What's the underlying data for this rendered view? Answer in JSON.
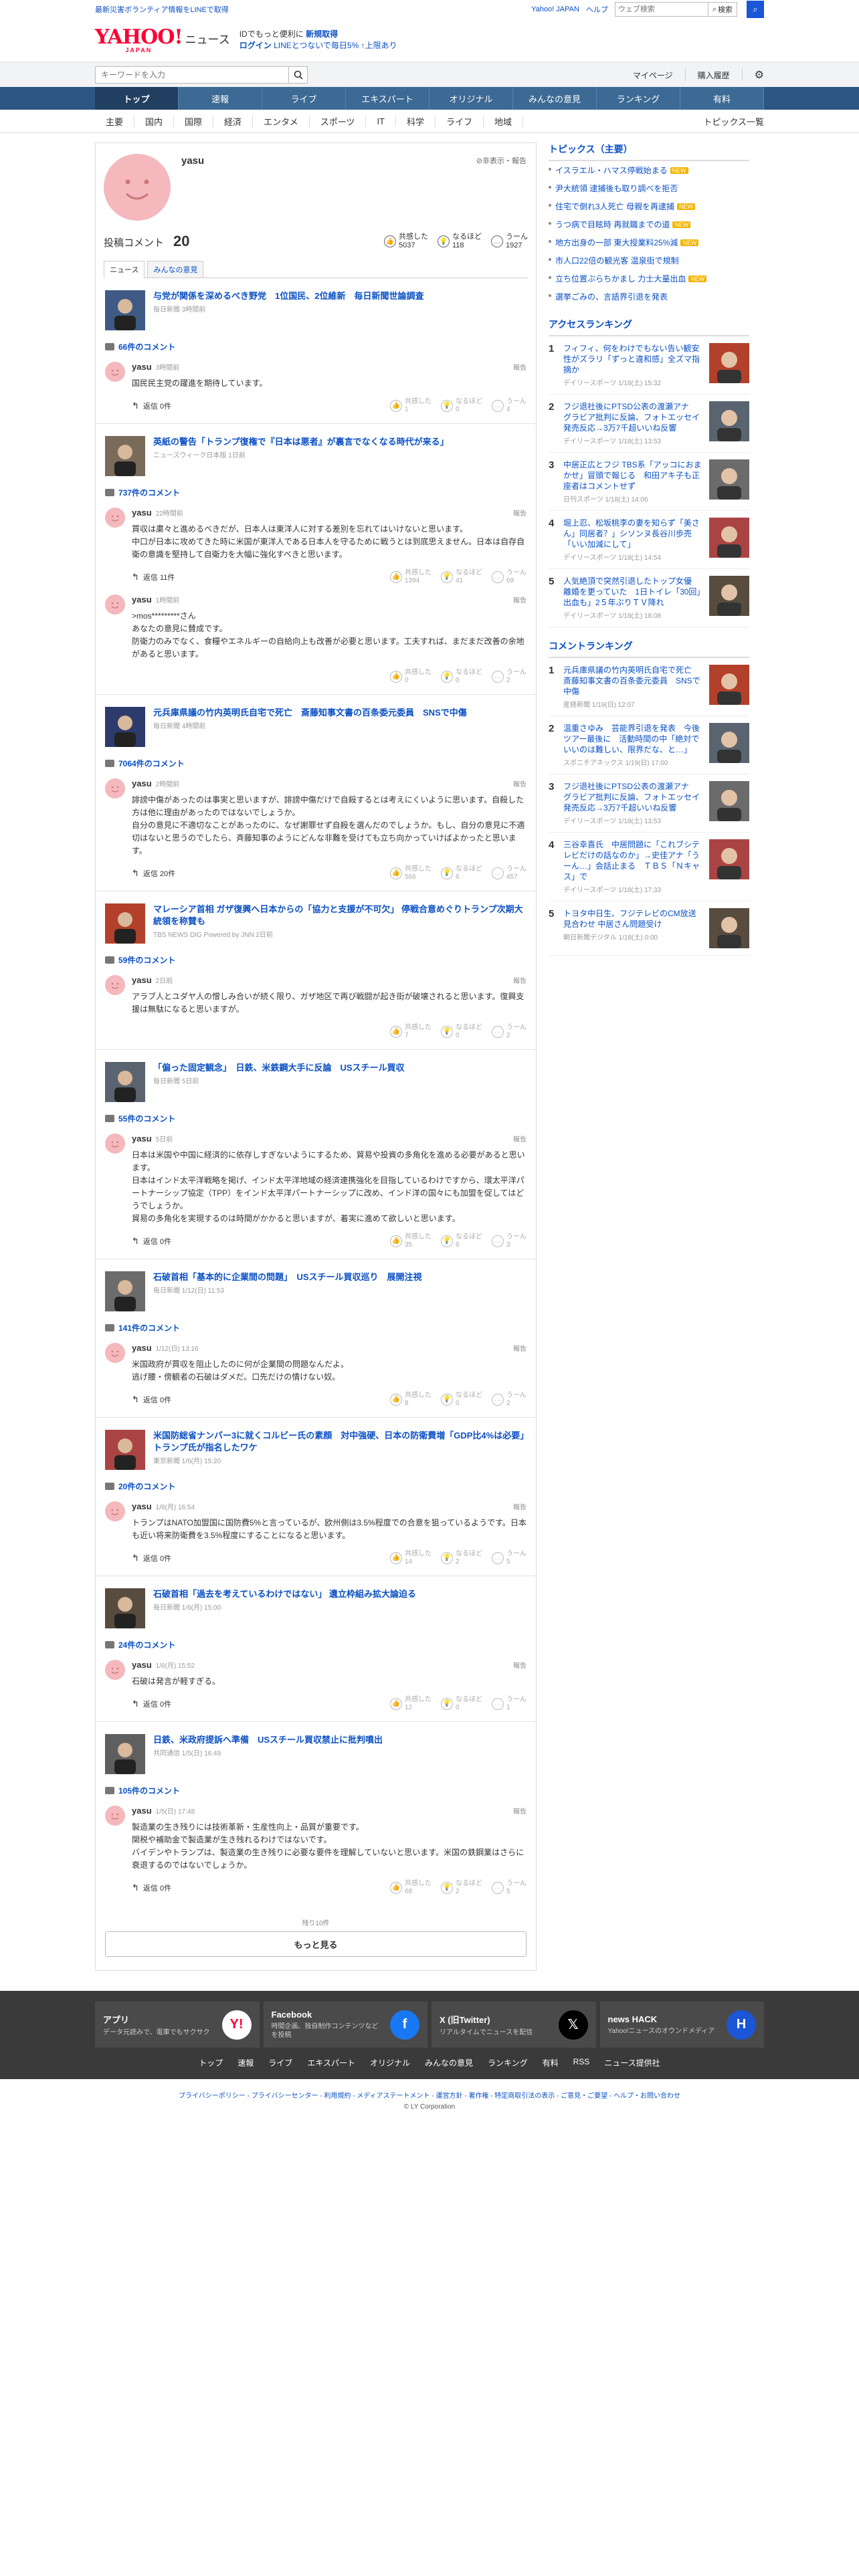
{
  "topstrip": {
    "disaster_link": "最新災害ボランティア情報をLINEで取得",
    "links": [
      "Yahoo! JAPAN",
      "ヘルプ"
    ],
    "search_placeholder": "ウェブ検索",
    "search_button": "検索"
  },
  "logo": {
    "yahoo": "YAHOO!",
    "japan": "JAPAN",
    "news": "ニュース"
  },
  "promo": {
    "line1_prefix": "IDでもっと便利に",
    "line1_link": "新規取得",
    "line2_link": "ログイン",
    "line2_text": "LINEとつないで毎日5% ↑上限あり"
  },
  "searchrow": {
    "placeholder": "キーワードを入力",
    "mypage": "マイページ",
    "history": "購入履歴"
  },
  "mainnav": [
    "トップ",
    "速報",
    "ライブ",
    "エキスパート",
    "オリジナル",
    "みんなの意見",
    "ランキング",
    "有料"
  ],
  "subnav": [
    "主要",
    "国内",
    "国際",
    "経済",
    "エンタメ",
    "スポーツ",
    "IT",
    "科学",
    "ライフ",
    "地域"
  ],
  "subnav_right": "トピックス一覧",
  "profile": {
    "name": "yasu",
    "private_note": "非表示・報告",
    "count_label": "投稿コメント",
    "count": "20",
    "reactions": [
      {
        "label": "共感した",
        "value": "5037",
        "icon": "thumb-icon"
      },
      {
        "label": "なるほど",
        "value": "118",
        "icon": "bulb-icon"
      },
      {
        "label": "うーん",
        "value": "1927",
        "icon": "hmm-icon"
      }
    ],
    "tabs": [
      "ニュース",
      "みんなの意見"
    ]
  },
  "articles": [
    {
      "title": "与党が関係を深めるべき野党　1位国民、2位維新　毎日新聞世論調査",
      "source": "毎日新聞 3時間前",
      "comment_count": "66件のコメント",
      "comments": [
        {
          "user": "yasu",
          "time": "3時間前",
          "text": "国民民主党の躍進を期待しています。",
          "reply": "返信 0件",
          "votes": [
            "共感した\n1",
            "なるほど\n0",
            "うーん\n4"
          ]
        }
      ]
    },
    {
      "title": "英紙の警告「トランプ復権で『日本は悪者』が裏言でなくなる時代が来る」",
      "source": "ニューズウィーク日本版 1日前",
      "comment_count": "737件のコメント",
      "comments": [
        {
          "user": "yasu",
          "time": "22時間前",
          "text": "買収は粛々と進めるべきだが、日本人は東洋人に対する差別を忘れてはいけないと思います。\n中口が日本に攻めてきた時に米国が東洋人である日本人を守るために戦うとは到底思えません。日本は自存自衛の意識を堅持して自衛力を大幅に強化すべきと思います。",
          "reply": "返信 11件",
          "votes": [
            "共感した\n1394",
            "なるほど\n41",
            "うーん\n69"
          ]
        },
        {
          "user": "yasu",
          "time": "1時間前",
          "text": ">mos*********さん\nあなたの意見に賛成です。\n防衛力のみでなく、食糧やエネルギーの自給向上も改善が必要と思います。工夫すれば、まだまだ改善の余地があると思います。",
          "reply": "",
          "votes": [
            "共感した\n0",
            "なるほど\n0",
            "うーん\n2"
          ]
        }
      ]
    },
    {
      "title": "元兵庫県議の竹内英明氏自宅で死亡　斎藤知事文書の百条委元委員　SNSで中傷",
      "source": "毎日新聞 4時間前",
      "comment_count": "7064件のコメント",
      "comments": [
        {
          "user": "yasu",
          "time": "2時間前",
          "text": "誹謗中傷があったのは事実と思いますが、誹謗中傷だけで自殺するとは考えにくいように思います。自殺した方は他に理由があったのではないでしょうか。\n自分の意見に不適切なことがあったのに、なぜ謝罪せず自殺を選んだのでしょうか。もし、自分の意見に不適切はないと思うのでしたら、斉藤知事のようにどんな非難を受けても立ち向かっていけばよかったと思います。",
          "reply": "返信 20件",
          "votes": [
            "共感した\n566",
            "なるほど\n6",
            "うーん\n457"
          ]
        }
      ]
    },
    {
      "title": "マレーシア首相 ガザ復興へ日本からの「協力と支援が不可欠」 停戦合意めぐりトランプ次期大統領を称賛も",
      "source": "TBS NEWS DIG Powered by JNN 2日前",
      "comment_count": "59件のコメント",
      "comments": [
        {
          "user": "yasu",
          "time": "2日前",
          "text": "アラブ人とユダヤ人の憎しみ合いが続く限り、ガザ地区で再び戦闘が起き街が破壊されると思います。復興支援は無駄になると思いますが。",
          "reply": "",
          "votes": [
            "共感した\n7",
            "なるほど\n0",
            "うーん\n2"
          ]
        }
      ]
    },
    {
      "title": "「偏った固定観念」　日鉄、米鉄鋼大手に反論　USスチール買収",
      "source": "毎日新聞 5日前",
      "comment_count": "55件のコメント",
      "comments": [
        {
          "user": "yasu",
          "time": "5日前",
          "text": "日本は米国や中国に経済的に依存しすぎないようにするため、貿易や投資の多角化を進める必要があると思います。\n日本はインド太平洋戦略を掲げ、インド太平洋地域の経済連携強化を目指しているわけですから、環太平洋パートナーシップ協定（TPP）をインド太平洋パートナーシップに改め、インド洋の国々にも加盟を促してはどうでしょうか。\n貿易の多角化を実現するのは時間がかかると思いますが、着実に進めて欲しいと思います。",
          "reply": "返信 0件",
          "votes": [
            "共感した\n35",
            "なるほど\n6",
            "うーん\n3"
          ]
        }
      ]
    },
    {
      "title": "石破首相「基本的に企業間の問題」　USスチール買収巡り　展開注視",
      "source": "毎日新聞 1/12(日) 11:53",
      "comment_count": "141件のコメント",
      "comments": [
        {
          "user": "yasu",
          "time": "1/12(日) 13:16",
          "text": "米国政府が買収を阻止したのに何が企業間の問題なんだよ。\n逃げ腰・傍観者の石破はダメだ。口先だけの情けない奴。",
          "reply": "返信 0件",
          "votes": [
            "共感した\n8",
            "なるほど\n0",
            "うーん\n2"
          ]
        }
      ]
    },
    {
      "title": "米国防総省ナンバー3に就くコルビー氏の素顔　対中強硬、日本の防衛費増「GDP比4%は必要」トランプ氏が指名したワケ",
      "source": "東京新聞 1/6(月) 15:20",
      "comment_count": "20件のコメント",
      "comments": [
        {
          "user": "yasu",
          "time": "1/6(月) 16:54",
          "text": "トランプはNATO加盟国に国防費5%と言っているが、欧州側は3.5%程度での合意を狙っているようです。日本も近い将来防衛費を3.5%程度にすることになると思います。",
          "reply": "返信 0件",
          "votes": [
            "共感した\n14",
            "なるほど\n2",
            "うーん\n5"
          ]
        }
      ]
    },
    {
      "title": "石破首相「過去を考えているわけではない」 遺立枠組み拡大論迫る",
      "source": "毎日新聞 1/6(月) 15:00",
      "comment_count": "24件のコメント",
      "comments": [
        {
          "user": "yasu",
          "time": "1/6(月) 15:52",
          "text": "石破は発言が軽すぎる。",
          "reply": "返信 0件",
          "votes": [
            "共感した\n12",
            "なるほど\n0",
            "うーん\n1"
          ]
        }
      ]
    },
    {
      "title": "日鉄、米政府提訴へ準備　USスチール買収禁止に批判噴出",
      "source": "共同通信 1/5(日) 16:49",
      "comment_count": "105件のコメント",
      "comments": [
        {
          "user": "yasu",
          "time": "1/5(日) 17:48",
          "text": "製造業の生き残りには技術革新・生産性向上・品質が重要です。\n関税や補助金で製造業が生き残れるわけではないです。\nバイデンやトランプは、製造業の生き残りに必要な要件を理解していないと思います。米国の鉄鋼業はさらに衰退するのではないでしょうか。",
          "reply": "返信 0件",
          "votes": [
            "共感した\n68",
            "なるほど\n2",
            "うーん\n5"
          ]
        }
      ]
    }
  ],
  "more": {
    "remain": "残り10件",
    "button": "もっと見る"
  },
  "sidebar": {
    "topics_heading": "トピックス（主要）",
    "topics": [
      {
        "text": "イスラエル・ハマス停戦始まる",
        "tag": "NEW"
      },
      {
        "text": "尹大統領 逮捕後も取り調べを拒否",
        "tag": ""
      },
      {
        "text": "住宅で倒れ3人死亡 母親を再逮捕",
        "tag": "NEW"
      },
      {
        "text": "うつ病で目眩時 再就職までの道",
        "tag": "NEW"
      },
      {
        "text": "地方出身の一部 東大授業料25%減",
        "tag": "NEW"
      },
      {
        "text": "市人口22倍の観光客 温泉街で規制",
        "tag": ""
      },
      {
        "text": "立ち位置ぶらちかまし 力士大量出血",
        "tag": "NEW"
      },
      {
        "text": "選挙ごみの、言語界引退を発表",
        "tag": ""
      }
    ],
    "access_heading": "アクセスランキング",
    "access": [
      {
        "title": "フィフィ、何をわけでもない告い観安性がズラリ「ずっと違和感」全ズマ指摘か",
        "src": "デイリースポーツ 1/18(土) 15:32"
      },
      {
        "title": "フジ退社後にPTSD公表の渡瀬アナ　グラビア批判に反論、フォトエッセイ発売反応→3万7千超いいね反響",
        "src": "デイリースポーツ 1/18(土) 13:53"
      },
      {
        "title": "中居正広とフジ TBS系「アッコにおまかせ」冒頭で報じる　和田アキ子も正座者はコメントせず",
        "src": "日刊スポーツ 1/18(土) 14:06"
      },
      {
        "title": "堀上忍、松坂桃李の妻を知らず「美さん」同居者？」シソンヌ長谷川歩売「いい加減にして」",
        "src": "デイリースポーツ 1/18(土) 14:54"
      },
      {
        "title": "人気絶頂で突然引退したトップ女優　離婚を更っていた　1日トイレ「30回」出血も」2５年ぶりＴＶ降れ",
        "src": "デイリースポーツ 1/18(土) 18:08"
      }
    ],
    "comment_heading": "コメントランキング",
    "comment": [
      {
        "title": "元兵庫県議の竹内英明氏自宅で死亡　斎藤知事文書の百条委元委員　SNSで中傷",
        "src": "産経新聞 1/19(日) 12:07"
      },
      {
        "title": "温重さゆみ　芸能界引退を発表　今後ツアー最後に　活動時間の中「絶対でいいのは難しい、限界だな、と…」",
        "src": "スポニチアネックス 1/19(日) 17:00"
      },
      {
        "title": "フジ退社後にPTSD公表の渡瀬アナ　グラビア批判に反論、フォトエッセイ発売反応→3万7千超いいね反響",
        "src": "デイリースポーツ 1/18(土) 13:53"
      },
      {
        "title": "三谷幸喜氏　中居問題に「これブシテレビだけの話なのか」→史佳アナ「うーん…」会話止まる　ＴＢＳ「Ｎキャス」で",
        "src": "デイリースポーツ 1/18(土) 17:33"
      },
      {
        "title": "トヨタ中日生、フジテレビのCM放送見合わせ 中居さん問題受け",
        "src": "朝日新聞デジタル 1/18(土) 0:00"
      }
    ]
  },
  "footer": {
    "apps": [
      {
        "title": "アプリ",
        "desc": "データ元読みで、電車でもサクサク",
        "icon": "app-icon",
        "color": "#ffffff"
      },
      {
        "title": "Facebook",
        "desc": "時間企画、独自制作コンテンツなどを投稿",
        "icon": "facebook-icon",
        "color": "#1877f2"
      },
      {
        "title": "X (旧Twitter)",
        "desc": "リアルタイムでニュースを配信",
        "icon": "x-icon",
        "color": "#000000"
      },
      {
        "title": "news HACK",
        "desc": "Yahoo!ニュースのオウンドメディア",
        "icon": "newshack-icon",
        "color": "#1a56d6"
      }
    ],
    "nav": [
      "トップ",
      "速報",
      "ライブ",
      "エキスパート",
      "オリジナル",
      "みんなの意見",
      "ランキング",
      "有料",
      "RSS",
      "ニュース提供社"
    ],
    "legal_links": "プライバシーポリシー - プライバシーセンター - 利用規約 - メディアステートメント - 運営方針 - 著作権 - 特定商取引法の表示 - ご意見・ご要望 - ヘルプ・お問い合わせ",
    "copyright": "© LY Corporation"
  }
}
